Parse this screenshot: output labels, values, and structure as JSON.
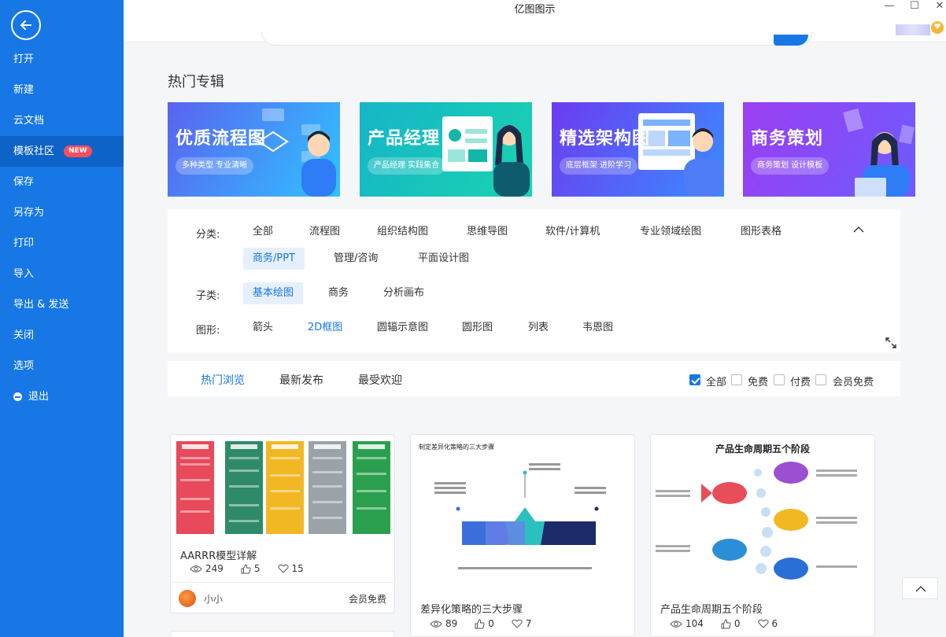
{
  "window": {
    "title": "亿图图示"
  },
  "sidebar": {
    "items": [
      {
        "label": "打开"
      },
      {
        "label": "新建"
      },
      {
        "label": "云文档"
      },
      {
        "label": "模板社区",
        "badge": "NEW",
        "active": true
      },
      {
        "label": "保存"
      },
      {
        "label": "另存为"
      },
      {
        "label": "打印"
      },
      {
        "label": "导入"
      },
      {
        "label": "导出 & 发送"
      },
      {
        "label": "关闭"
      },
      {
        "label": "选项"
      },
      {
        "label": "退出"
      }
    ]
  },
  "section_title": "热门专辑",
  "banners": [
    {
      "title": "优质流程图",
      "sub": "多种类型 专业清晰"
    },
    {
      "title": "产品经理",
      "sub": "产品经理 实践集合"
    },
    {
      "title": "精选架构图",
      "sub": "底层框架 进阶学习"
    },
    {
      "title": "商务策划",
      "sub": "商务策划 设计模板"
    }
  ],
  "filters": {
    "category_label": "分类:",
    "categories": [
      "全部",
      "流程图",
      "组织结构图",
      "思维导图",
      "软件/计算机",
      "专业领域绘图",
      "图形表格",
      "商务/PPT",
      "管理/咨询",
      "平面设计图"
    ],
    "subcategory_label": "子类:",
    "subcategories": [
      "基本绘图",
      "商务",
      "分析画布"
    ],
    "shape_label": "图形:",
    "shapes": [
      "箭头",
      "2D框图",
      "圆辐示意图",
      "圆形图",
      "列表",
      "韦恩图"
    ]
  },
  "tabs": [
    "热门浏览",
    "最新发布",
    "最受欢迎"
  ],
  "price_filters": [
    "全部",
    "免费",
    "付费",
    "会员免费"
  ],
  "cards": [
    {
      "name": "AARRR模型详解",
      "views": "249",
      "likes": "5",
      "favs": "15",
      "author": "小小",
      "price": "会员免费"
    },
    {
      "name": "差异化策略的三大步骤",
      "views": "89",
      "likes": "0",
      "favs": "7",
      "thumb_title": "制定差异化策略的三大步骤"
    },
    {
      "name": "产品生命周期五个阶段",
      "views": "104",
      "likes": "0",
      "favs": "6",
      "thumb_title": "产品生命周期五个阶段"
    }
  ],
  "colors": {
    "brand": "#1677e5",
    "badge": "#ff4d5e"
  }
}
